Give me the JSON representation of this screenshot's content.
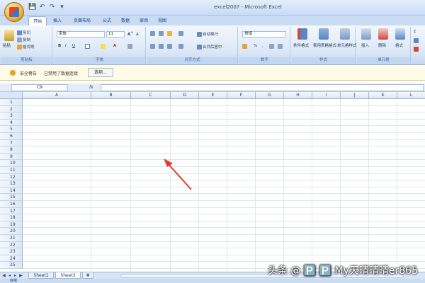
{
  "window": {
    "title": "excel2007 - Microsoft Excel"
  },
  "quick_access": {
    "save": "💾",
    "undo": "↶",
    "redo": "↷",
    "more": "▾"
  },
  "tabs": [
    "开始",
    "插入",
    "页面布局",
    "公式",
    "数据",
    "审阅",
    "视图"
  ],
  "ribbon": {
    "clipboard": {
      "paste": "粘贴",
      "cut": "剪切",
      "copy": "复制",
      "format_painter": "格式刷",
      "label": "剪贴板"
    },
    "font": {
      "name": "宋体",
      "size": "11",
      "bold": "B",
      "italic": "I",
      "underline": "U",
      "label": "字体"
    },
    "alignment": {
      "wrap": "自动换行",
      "merge": "合并后居中",
      "label": "对齐方式"
    },
    "number": {
      "format": "常规",
      "percent": "%",
      "comma": ",",
      "label": "数字"
    },
    "styles": {
      "conditional": "条件格式",
      "table": "套用表格格式",
      "cell": "单元格样式",
      "label": "样式"
    },
    "cells": {
      "insert": "插入",
      "delete": "删除",
      "format": "格式",
      "label": "单元格"
    }
  },
  "security": {
    "warning": "安全警告",
    "message": "已禁用了数据连接",
    "options": "选项..."
  },
  "formula_bar": {
    "name_box": "C9",
    "fx": "fx"
  },
  "columns": [
    "A",
    "B",
    "C",
    "D",
    "E",
    "F",
    "G",
    "H",
    "I",
    "J",
    "K",
    "L"
  ],
  "rows": [
    "1",
    "2",
    "3",
    "4",
    "5",
    "6",
    "7",
    "8",
    "9",
    "10",
    "11",
    "12",
    "13",
    "14",
    "15",
    "16",
    "17",
    "18",
    "19",
    "20",
    "21",
    "22",
    "23",
    "24",
    "25"
  ],
  "sheets": [
    "Sheet1",
    "Sheet3"
  ],
  "status": "就绪",
  "watermark": "头条 @ 🅿️ 🅿️ My天晴晴晴er865",
  "colors": {
    "ribbon": "#dbe7f6",
    "arrow": "#e8392b",
    "header": "#dce7f5"
  }
}
